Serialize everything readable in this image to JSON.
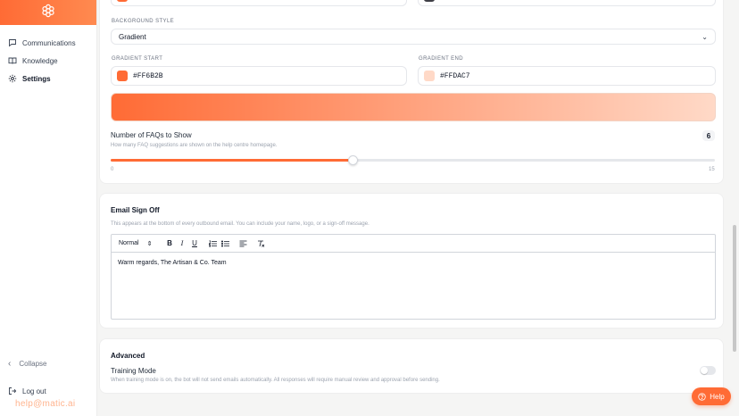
{
  "sidebar": {
    "items": [
      {
        "label": "Communications",
        "icon": "chat-bubble-icon"
      },
      {
        "label": "Knowledge",
        "icon": "book-icon"
      },
      {
        "label": "Settings",
        "icon": "gear-icon"
      }
    ],
    "collapse_label": "Collapse",
    "logout_label": "Log out",
    "wordmark": "help@matic.ai"
  },
  "appearance": {
    "background_style_label": "BACKGROUND STYLE",
    "background_style_value": "Gradient",
    "gradient_start_label": "GRADIENT START",
    "gradient_start_value": "#FF6B2B",
    "gradient_end_label": "GRADIENT END",
    "gradient_end_value": "#FFDAC7",
    "gradient_start_color": "#ff6b35",
    "gradient_end_color": "#ffd9c7"
  },
  "faqs": {
    "title": "Number of FAQs to Show",
    "description": "How many FAQ suggestions are shown on the help centre homepage.",
    "value": "6",
    "min": "0",
    "max": "15",
    "fraction": 0.4
  },
  "email_signoff": {
    "title": "Email Sign Off",
    "description": "This appears at the bottom of every outbound email. You can include your name, logo, or a sign-off message.",
    "toolbar": {
      "format": "Normal",
      "bold": "B",
      "italic": "I",
      "underline": "U",
      "ordered_list": "ordered-list-icon",
      "bullet_list": "bullet-list-icon",
      "align": "align-left-icon",
      "clear": "clear-format-icon"
    },
    "content": "Warm regards, The Artisan & Co. Team"
  },
  "advanced": {
    "title": "Advanced",
    "training_title": "Training Mode",
    "training_description": "When training mode is on, the bot will not send emails automatically. All responses will require manual review and approval before sending.",
    "training_enabled": false
  },
  "help_label": "Help",
  "colors": {
    "accent": "#ff6b35"
  }
}
